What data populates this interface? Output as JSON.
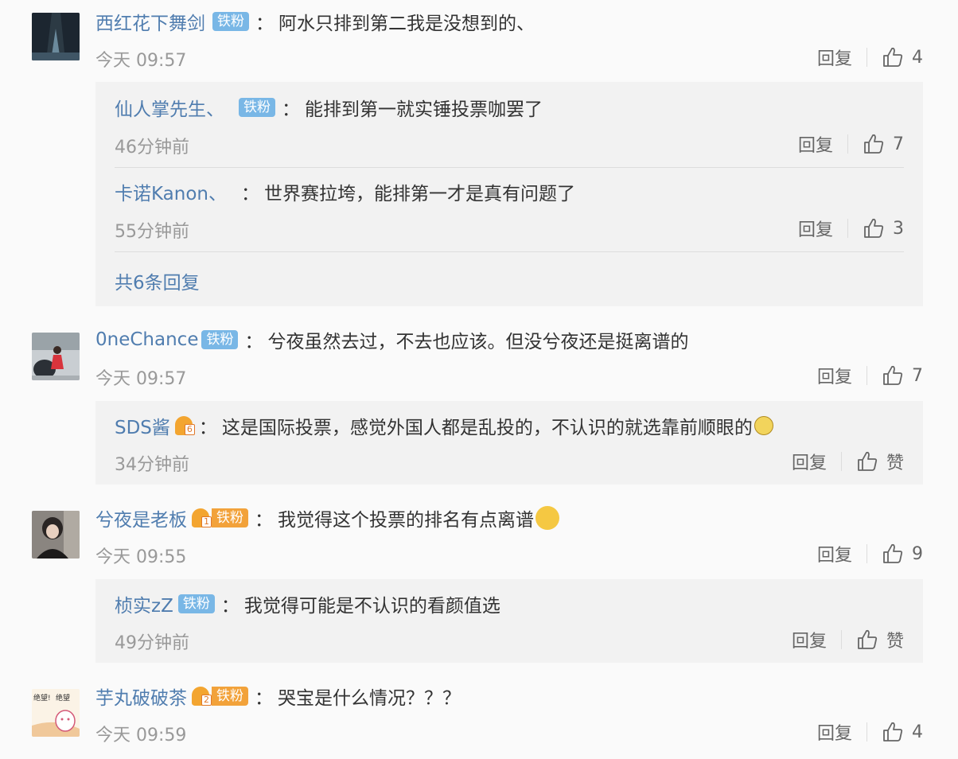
{
  "common": {
    "reply_label": "回复",
    "like_label": "赞",
    "badge_text": "铁粉"
  },
  "comments": [
    {
      "username": "西红花下舞剑",
      "text": "阿水只排到第二我是没想到的、",
      "time": "今天 09:57",
      "likes": "4",
      "replies": [
        {
          "username": "仙人掌先生、",
          "text": "能排到第一就实锤投票咖罢了",
          "time": "46分钟前",
          "likes": "7"
        },
        {
          "username": "卡诺Kanon、",
          "text": "世界赛拉垮，能排第一才是真有问题了",
          "time": "55分钟前",
          "likes": "3"
        }
      ],
      "total_replies": "共6条回复"
    },
    {
      "username": "0neChance",
      "text": "兮夜虽然去过，不去也应该。但没兮夜还是挺离谱的",
      "time": "今天 09:57",
      "likes": "7",
      "replies": [
        {
          "username": "SDS酱",
          "crown_level": "6",
          "text": "这是国际投票，感觉外国人都是乱投的，不认识的就选靠前顺眼的",
          "time": "34分钟前",
          "likes": "赞"
        }
      ]
    },
    {
      "username": "兮夜是老板",
      "crown_level": "1",
      "text": "我觉得这个投票的排名有点离谱",
      "time": "今天 09:55",
      "likes": "9",
      "replies": [
        {
          "username": "桢实zZ",
          "text": "我觉得可能是不认识的看颜值选",
          "time": "49分钟前",
          "likes": "赞"
        }
      ]
    },
    {
      "username": "芋丸破破茶",
      "crown_level": "2",
      "text": "哭宝是什么情况？？？",
      "time": "今天 09:59",
      "likes": "4"
    }
  ],
  "avatar_texts": [
    "绝望!",
    "绝望"
  ],
  "colors": {
    "username": "#507daf",
    "badge": "#79b7e6",
    "fan_badge": "#f2a23a",
    "reply_bg": "#f2f2f2",
    "meta": "#999999"
  }
}
